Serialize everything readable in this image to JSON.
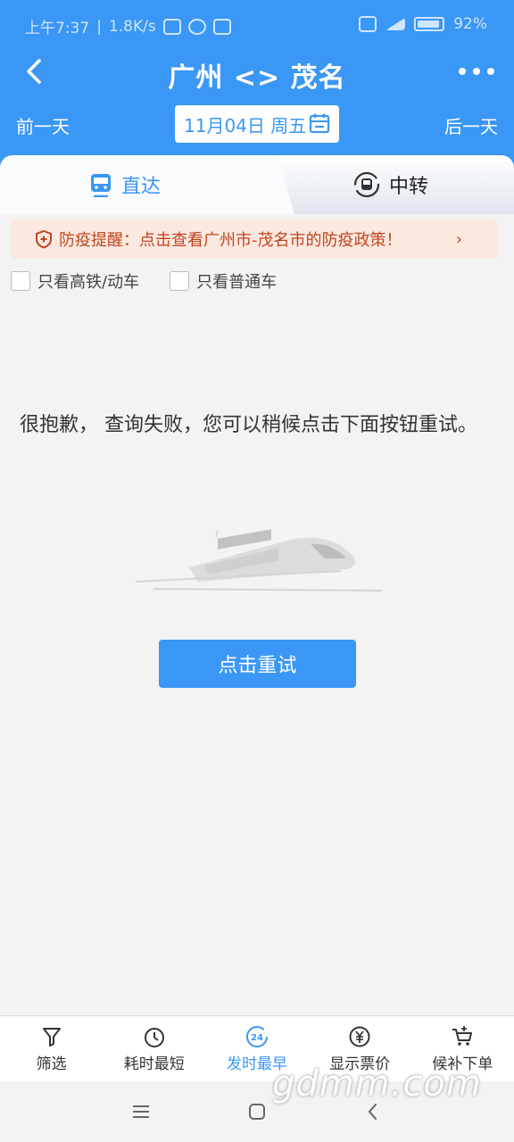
{
  "status_bar": {
    "time": "上午7:37",
    "speed": "1.8K/s",
    "battery": "92%"
  },
  "nav": {
    "title": "广州 <> 茂名"
  },
  "date_nav": {
    "prev_label": "前一天",
    "date": "11月04日 周五",
    "next_label": "后一天"
  },
  "tabs": [
    {
      "label": "直达",
      "active": true
    },
    {
      "label": "中转",
      "active": false
    }
  ],
  "notice": {
    "text": "防疫提醒：点击查看广州市-茂名市的防疫政策！"
  },
  "filters": [
    {
      "label": "只看高铁/动车",
      "checked": false
    },
    {
      "label": "只看普通车",
      "checked": false
    }
  ],
  "error": {
    "message": "很抱歉， 查询失败，您可以稍候点击下面按钮重试。"
  },
  "retry_label": "点击重试",
  "toolbar": [
    {
      "label": "筛选",
      "icon": "filter-icon"
    },
    {
      "label": "耗时最短",
      "icon": "timer-icon"
    },
    {
      "label": "发时最早",
      "icon": "clock-24-icon",
      "active": true,
      "badge": "24"
    },
    {
      "label": "显示票价",
      "icon": "yen-icon"
    },
    {
      "label": "候补下单",
      "icon": "cart-icon"
    }
  ],
  "watermark": "gdmm.com",
  "colors": {
    "primary": "#3a97f5",
    "notice_bg": "#fbe9e0",
    "notice_text": "#c0441e"
  }
}
